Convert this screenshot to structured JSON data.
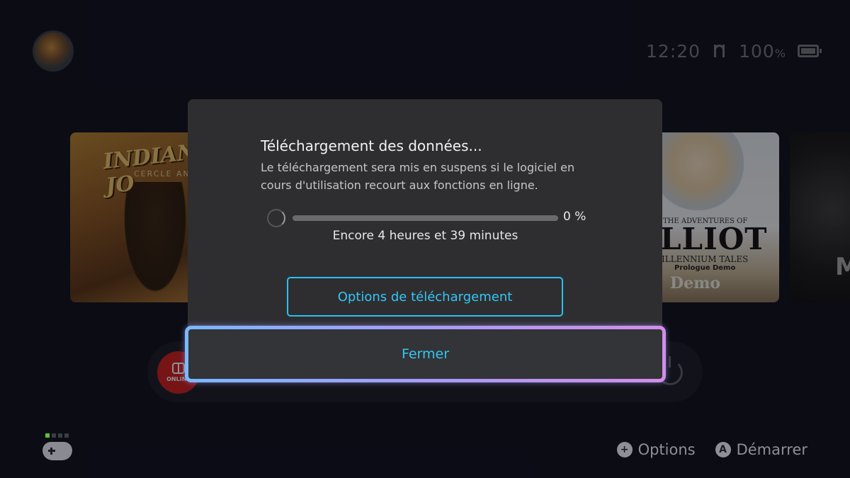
{
  "status_bar": {
    "time": "12:20",
    "battery_value": "100",
    "battery_unit": "%"
  },
  "tiles": {
    "indiana": {
      "title": "INDIANA JO",
      "subtitle": "CERCLE ANC"
    },
    "eliot": {
      "line1": "THE ADVENTURES OF",
      "line2": "LLIOT",
      "line3": "ILLENNIUM TALES",
      "line4": "Prologue Demo",
      "line5": "Demo"
    },
    "dark": {
      "letter": "M"
    }
  },
  "dock": {
    "online_label": "ONLINE"
  },
  "dialog": {
    "title": "Téléchargement des données...",
    "message": "Le téléchargement sera mis en suspens si le logiciel en cours d'utilisation recourt aux fonctions en ligne.",
    "progress_percent": 0,
    "progress_label": "0 %",
    "eta": "Encore 4 heures et 39 minutes",
    "options_button": "Options de téléchargement",
    "close_button": "Fermer"
  },
  "hints": {
    "options": {
      "key": "+",
      "label": "Options"
    },
    "start": {
      "key": "A",
      "label": "Démarrer"
    }
  },
  "colors": {
    "accent": "#35c6f4",
    "background": "#0d0f1a",
    "dialog": "#2e2e31",
    "online_red": "#d01e1e"
  },
  "icons": [
    "user-avatar-icon",
    "wifi-icon",
    "battery-icon",
    "nintendo-online-icon",
    "power-icon",
    "controller-icon",
    "plus-button-icon",
    "a-button-icon",
    "loading-spinner-icon"
  ]
}
